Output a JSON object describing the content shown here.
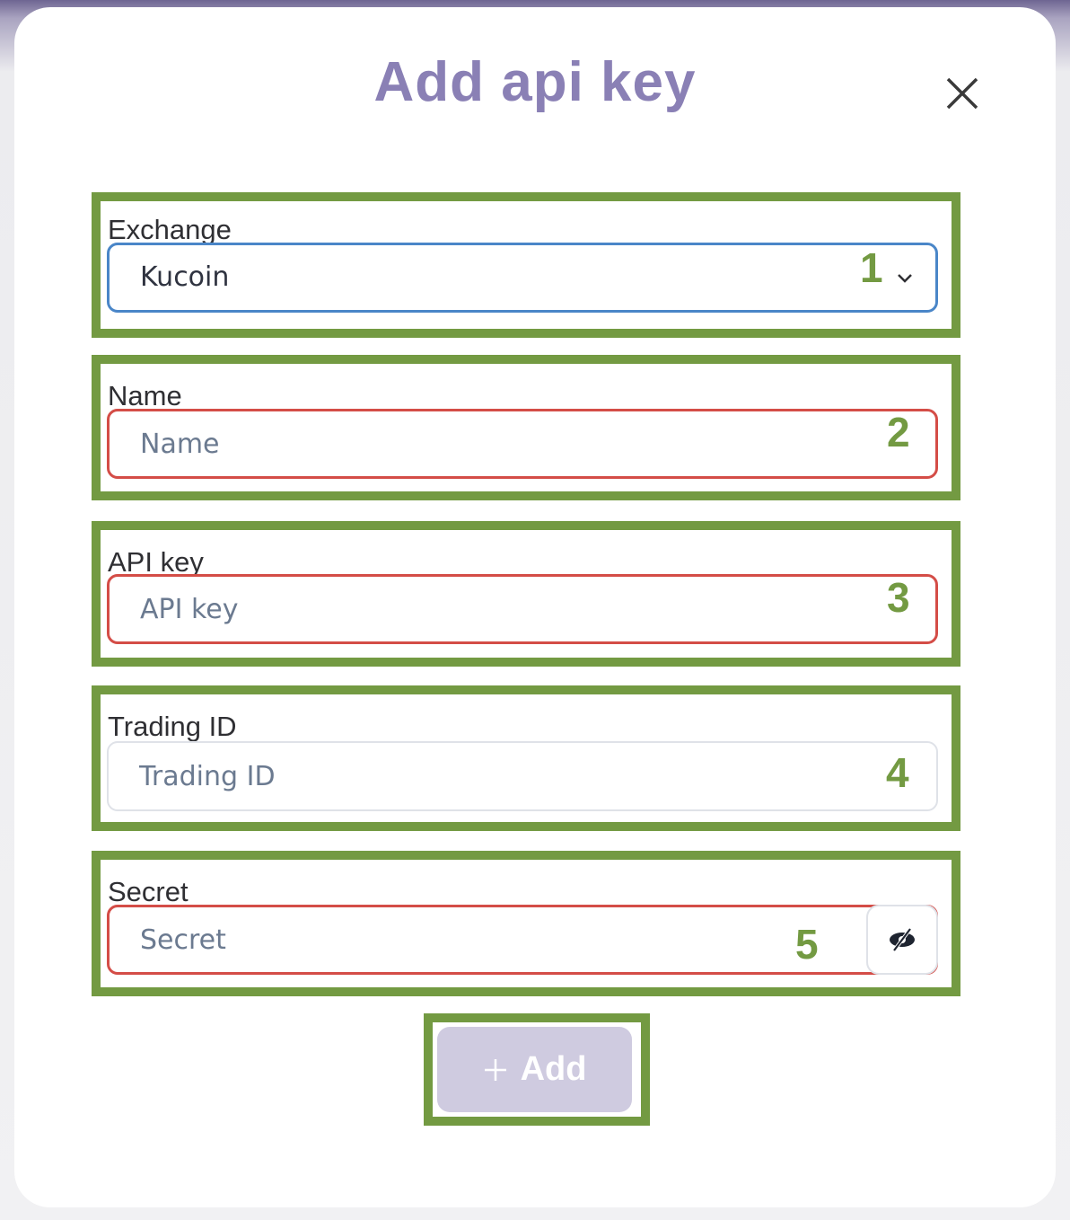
{
  "dialog": {
    "title": "Add api key",
    "close_icon": "close-icon"
  },
  "fields": [
    {
      "label": "Exchange",
      "value": "Kucoin",
      "annotation": "1"
    },
    {
      "label": "Name",
      "placeholder": "Name",
      "annotation": "2"
    },
    {
      "label": "API key",
      "placeholder": "API key",
      "annotation": "3"
    },
    {
      "label": "Trading ID",
      "placeholder": "Trading ID",
      "annotation": "4"
    },
    {
      "label": "Secret",
      "placeholder": "Secret",
      "annotation": "5"
    }
  ],
  "add_button": {
    "label": "Add",
    "icon": "plus-icon"
  },
  "colors": {
    "title": "#8a80b5",
    "annotation": "#739a42",
    "error": "#d44d47",
    "focus": "#4a86c8",
    "button": "#cfcbe0"
  }
}
